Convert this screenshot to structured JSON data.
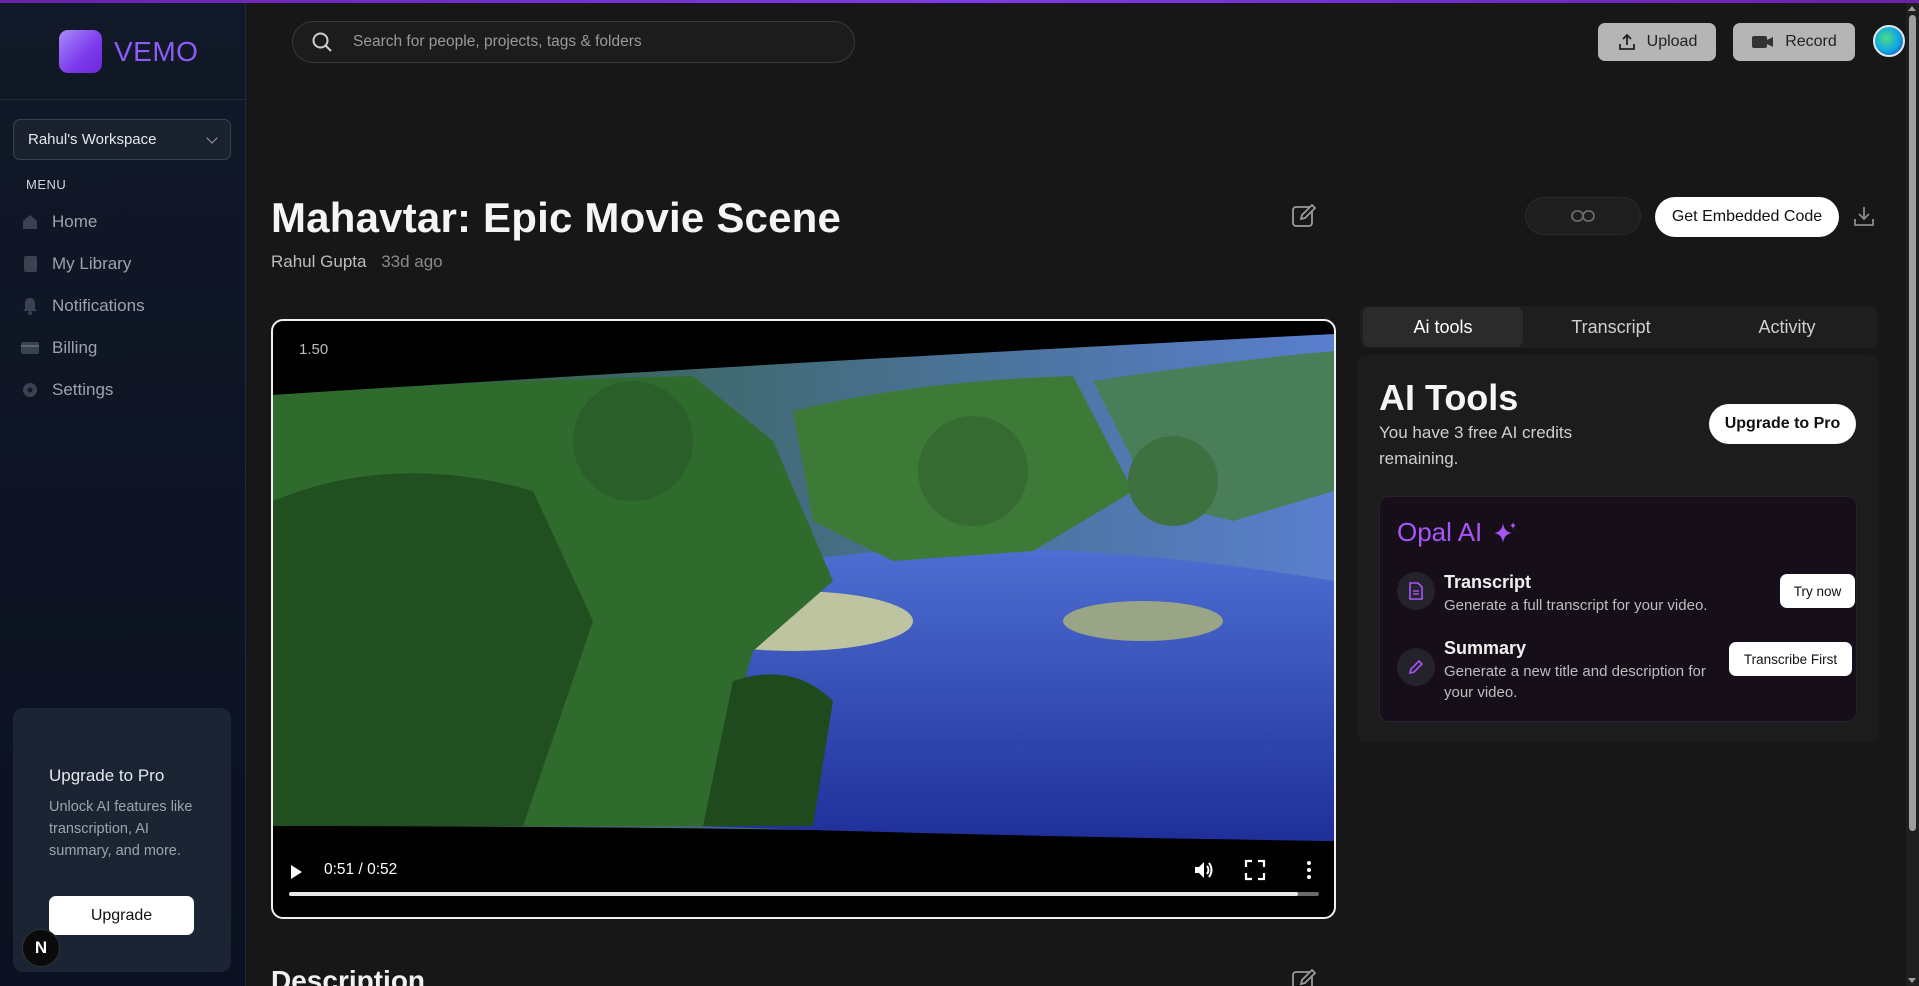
{
  "app": {
    "name": "VEMO",
    "accent": "#8b5cf6"
  },
  "sidebar": {
    "workspace": "Rahul's Workspace",
    "menu_label": "MENU",
    "items": [
      {
        "label": "Home",
        "icon": "home-icon"
      },
      {
        "label": "My Library",
        "icon": "library-icon"
      },
      {
        "label": "Notifications",
        "icon": "bell-icon"
      },
      {
        "label": "Billing",
        "icon": "credit-card-icon"
      },
      {
        "label": "Settings",
        "icon": "gear-icon"
      }
    ],
    "upgrade": {
      "title": "Upgrade to Pro",
      "description": "Unlock AI features like transcription, AI summary, and more.",
      "button": "Upgrade"
    },
    "badge": "N"
  },
  "header": {
    "search_placeholder": "Search for people, projects, tags & folders",
    "upload_label": "Upload",
    "record_label": "Record"
  },
  "video": {
    "title": "Mahavtar: Epic Movie Scene",
    "author": "Rahul Gupta",
    "age": "33d ago",
    "embed_label": "Get Embedded Code",
    "speed": "1.50",
    "time": "0:51 / 0:52",
    "progress": 0.98
  },
  "panel": {
    "tabs": [
      "Ai tools",
      "Transcript",
      "Activity"
    ],
    "ai_title": "AI Tools",
    "ai_subtitle": "You have 3 free AI credits remaining.",
    "upgrade_label": "Upgrade to Pro",
    "opal_title": "Opal AI",
    "features": [
      {
        "title": "Transcript",
        "description": "Generate a full transcript for your video.",
        "button": "Try now"
      },
      {
        "title": "Summary",
        "description": "Generate a new title and description for your video.",
        "button": "Transcribe First"
      }
    ]
  },
  "description": {
    "heading": "Description"
  }
}
